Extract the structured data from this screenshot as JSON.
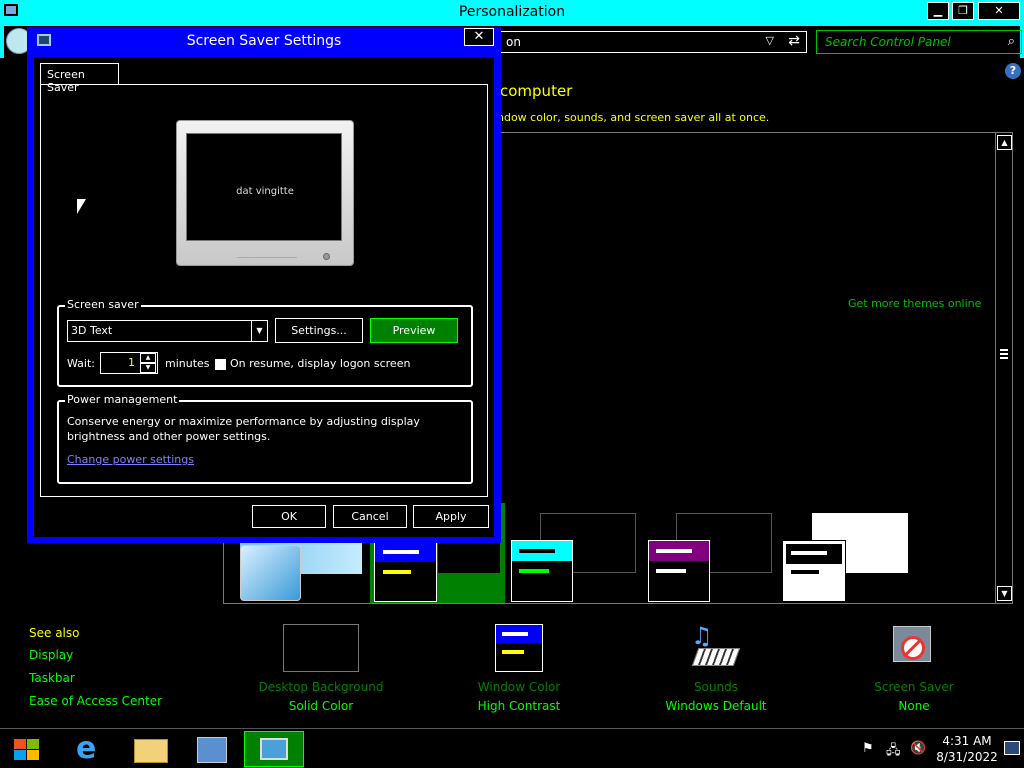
{
  "window": {
    "title": "Personalization",
    "minimize_icon": "minimize-icon",
    "restore_icon": "restore-icon",
    "close_icon": "close-icon"
  },
  "address": {
    "crumb_text": "on",
    "search_placeholder": "Search Control Panel"
  },
  "main": {
    "heading": "computer",
    "subheading": "ndow color, sounds, and screen saver all at once.",
    "get_more": "Get more themes online"
  },
  "sidebar": {
    "see_also": "See also",
    "items": [
      "Display",
      "Taskbar",
      "Ease of Access Center"
    ]
  },
  "bottom": [
    {
      "label": "Desktop Background",
      "value": "Solid Color",
      "icon": "desktop-background-icon"
    },
    {
      "label": "Window Color",
      "value": "High Contrast",
      "icon": "window-color-icon"
    },
    {
      "label": "Sounds",
      "value": "Windows Default",
      "icon": "sounds-icon"
    },
    {
      "label": "Screen Saver",
      "value": "None",
      "icon": "screen-saver-icon"
    }
  ],
  "dialog": {
    "title": "Screen Saver Settings",
    "tab": "Screen Saver",
    "preview_text": "dat vingitte",
    "screensaver_group": "Screen saver",
    "screensaver_value": "3D Text",
    "settings_button": "Settings...",
    "preview_button": "Preview",
    "wait_label": "Wait:",
    "wait_value": "1",
    "minutes_label": "minutes",
    "resume_label": "On resume, display logon screen",
    "power_group": "Power management",
    "power_text_1": "Conserve energy or maximize performance by adjusting display",
    "power_text_2": "brightness and other power settings.",
    "power_link": "Change power settings",
    "ok": "OK",
    "cancel": "Cancel",
    "apply": "Apply"
  },
  "taskbar": {
    "time": "4:31 AM",
    "date": "8/31/2022"
  },
  "colors": {
    "titlebar": "#00ffff",
    "dialog": "#0000ff",
    "accent_green": "#00ff00",
    "accent_yellow": "#ffff00"
  }
}
